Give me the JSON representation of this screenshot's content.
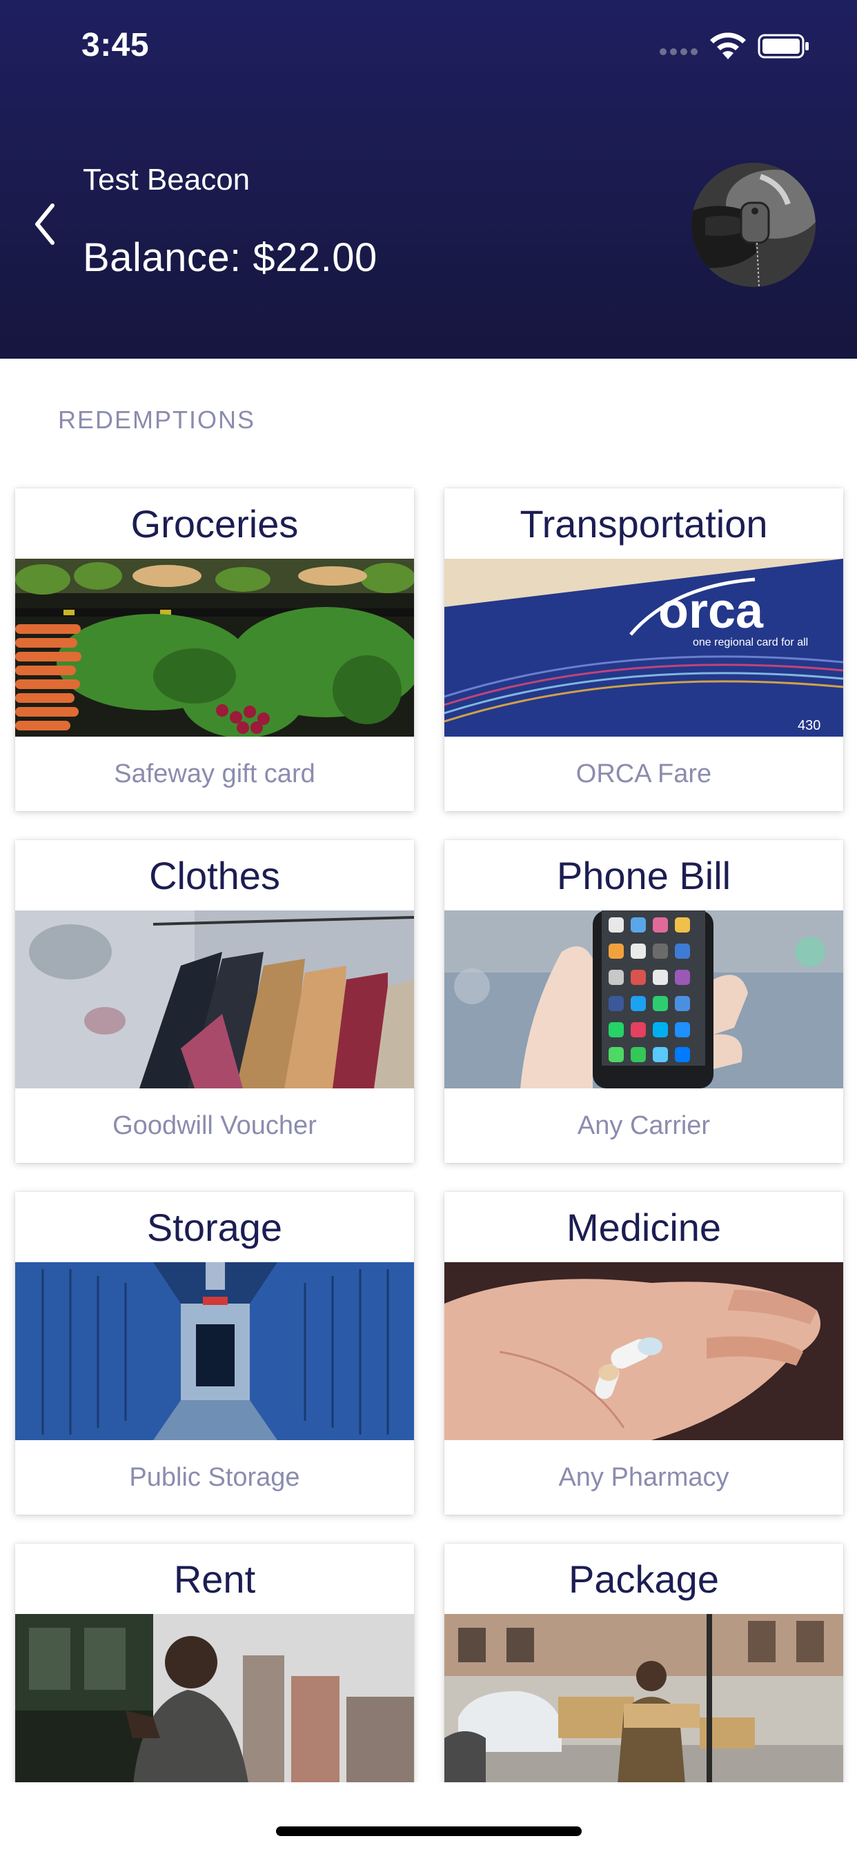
{
  "status_bar": {
    "time": "3:45"
  },
  "header": {
    "name": "Test Beacon",
    "balance": "Balance: $22.00",
    "back_icon": "chevron-left-icon",
    "avatar_icon": "beacon-keychain-photo"
  },
  "section": {
    "title": "REDEMPTIONS"
  },
  "cards": [
    {
      "title": "Groceries",
      "subtitle": "Safeway gift card"
    },
    {
      "title": "Transportation",
      "subtitle": "ORCA Fare",
      "image_text": "orca",
      "image_tagline": "one regional card for all",
      "image_number": "430"
    },
    {
      "title": "Clothes",
      "subtitle": "Goodwill Voucher"
    },
    {
      "title": "Phone Bill",
      "subtitle": "Any Carrier"
    },
    {
      "title": "Storage",
      "subtitle": "Public Storage"
    },
    {
      "title": "Medicine",
      "subtitle": "Any Pharmacy"
    },
    {
      "title": "Rent",
      "subtitle": ""
    },
    {
      "title": "Package",
      "subtitle": ""
    }
  ],
  "colors": {
    "header_bg": "#1e1f5f",
    "card_title": "#1c1d52",
    "muted_text": "#8b8cae"
  }
}
